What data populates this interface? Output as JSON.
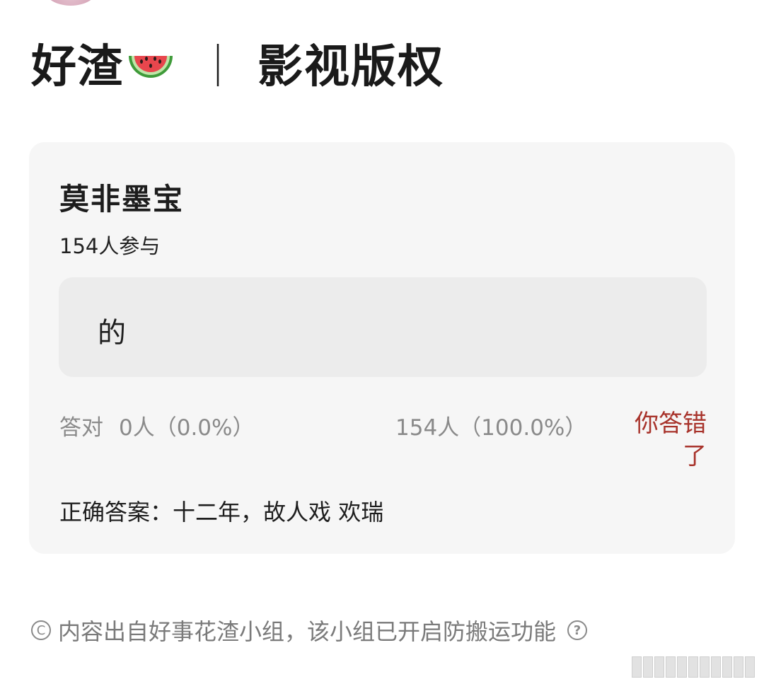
{
  "header": {
    "title_left": "好渣",
    "separator": "｜",
    "title_right": "影视版权",
    "emoji_icon": "watermelon-icon"
  },
  "quiz": {
    "title": "莫非墨宝",
    "participants": "154人参与",
    "option_text": "的",
    "stats": {
      "correct_label": "答对",
      "correct_value": "0人（0.0%）",
      "wrong_value": "154人（100.0%）",
      "result_tag": "你答错了"
    },
    "answer_label": "正确答案：",
    "answer_value": "十二年，故人戏 欢瑞"
  },
  "footer": {
    "note": "内容出自好事花渣小组，该小组已开启防搬运功能",
    "copyright_icon": "copyright-icon",
    "help_icon": "help-icon"
  },
  "colors": {
    "card_background": "#f6f6f6",
    "option_background": "#ececec",
    "muted_text": "#8a8a8a",
    "wrong_accent": "#a8332b"
  }
}
